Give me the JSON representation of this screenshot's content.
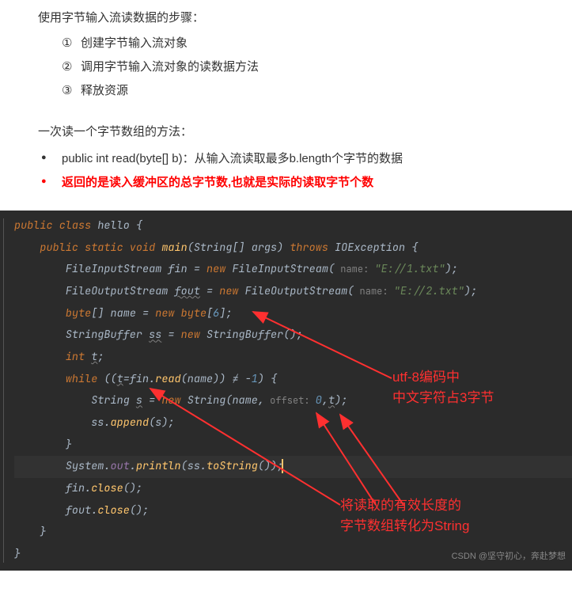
{
  "doc": {
    "heading1": "使用字节输入流读数据的步骤：",
    "steps": [
      {
        "num": "①",
        "text": "创建字节输入流对象"
      },
      {
        "num": "②",
        "text": "调用字节输入流对象的读数据方法"
      },
      {
        "num": "③",
        "text": "释放资源"
      }
    ],
    "heading2": "一次读一个字节数组的方法：",
    "bullets": [
      {
        "text": "public int read(byte[] b)：从输入流读取最多b.length个字节的数据",
        "red": false
      },
      {
        "text": "返回的是读入缓冲区的总字节数,也就是实际的读取字节个数",
        "red": true
      }
    ]
  },
  "code": {
    "l1": {
      "kw1": "public class ",
      "cls": "hello",
      "br": " {"
    },
    "l2": {
      "kw1": "public static void ",
      "m": "main",
      "p1": "(String[] args) ",
      "kw2": "throws ",
      "ex": "IOException {"
    },
    "l3": {
      "cls": "FileInputStream ",
      "v": "fin",
      "eq": " = ",
      "kw": "new ",
      "ctor": "FileInputStream",
      "p1": "(",
      "hint": " name: ",
      "s": "\"E://1.txt\"",
      "p2": ");"
    },
    "l4": {
      "cls": "FileOutputStream ",
      "v": "fout",
      "eq": " = ",
      "kw": "new ",
      "ctor": "FileOutputStream",
      "p1": "(",
      "hint": " name: ",
      "s": "\"E://2.txt\"",
      "p2": ");"
    },
    "l5": {
      "kw": "byte",
      "arr": "[] ",
      "v": "name",
      "eq": " = ",
      "kw2": "new byte",
      "br": "[",
      "n": "6",
      "br2": "];"
    },
    "l6": {
      "cls": "StringBuffer ",
      "v": "ss",
      "eq": " = ",
      "kw": "new ",
      "ctor": "StringBuffer",
      "p": "();"
    },
    "l7": {
      "kw": "int ",
      "v": "t",
      "sc": ";"
    },
    "l8": {
      "kw": "while ",
      "p1": "((",
      "v1": "t",
      "eq": "=fin.",
      "m": "read",
      "p2": "(name)) ",
      "ne": "≠",
      "sp": " -",
      "n": "1",
      "p3": ") {"
    },
    "l9": {
      "cls": "String ",
      "v": "s",
      "eq": " = ",
      "kw": "new ",
      "ctor": "String",
      "p1": "(name,",
      "hint": " offset: ",
      "n1": "0",
      "c": ",",
      "v2": "t",
      "p2": ");"
    },
    "l10": {
      "v": "ss",
      "dot": ".",
      "m": "append",
      "p": "(s);"
    },
    "l11": {
      "br": "}"
    },
    "l12": {
      "cls": "System.",
      "it": "out",
      "dot": ".",
      "m": "println",
      "p1": "(ss.",
      "m2": "toString",
      "p2": "());"
    },
    "l13": {
      "v": "fin",
      "dot": ".",
      "m": "close",
      "p": "();"
    },
    "l14": {
      "v": "fout",
      "dot": ".",
      "m": "close",
      "p": "();"
    },
    "l15": {
      "br": "}"
    },
    "l16": {
      "br": "}"
    }
  },
  "annotations": {
    "a1_l1": "utf-8编码中",
    "a1_l2": "中文字符占3字节",
    "a2_l1": "将读取的有效长度的",
    "a2_l2": "字节数组转化为String"
  },
  "watermark": "CSDN @坚守初心，奔赴梦想"
}
